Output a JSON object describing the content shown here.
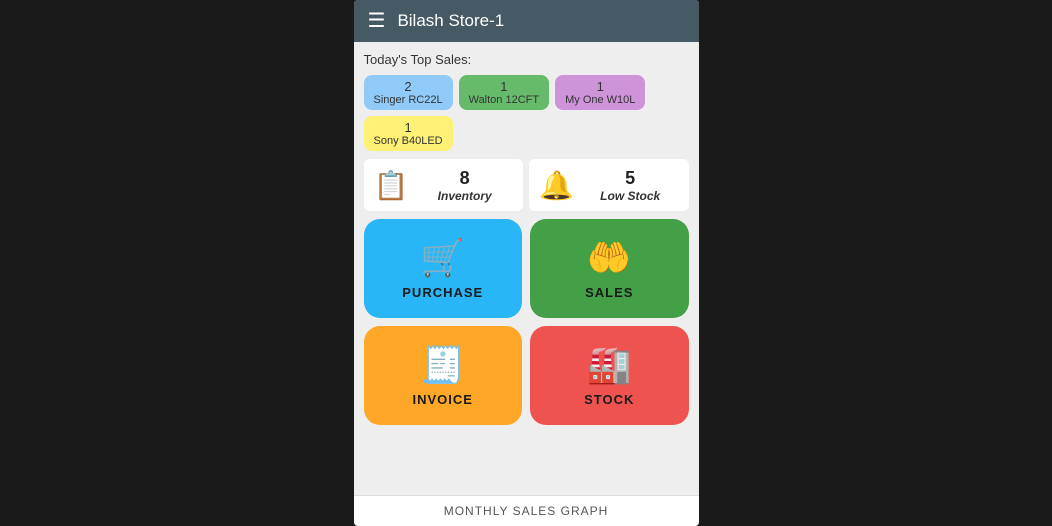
{
  "header": {
    "title": "Bilash Store-1",
    "menu_icon": "☰"
  },
  "today_sales": {
    "label": "Today's Top Sales:",
    "chips": [
      {
        "count": "2",
        "name": "Singer RC22L",
        "color": "chip-blue"
      },
      {
        "count": "1",
        "name": "Walton 12CFT",
        "color": "chip-green"
      },
      {
        "count": "1",
        "name": "My One W10L",
        "color": "chip-purple"
      },
      {
        "count": "1",
        "name": "Sony B40LED",
        "color": "chip-yellow"
      }
    ]
  },
  "stats": [
    {
      "number": "8",
      "label": "Inventory",
      "icon": "📄"
    },
    {
      "number": "5",
      "label": "Low Stock",
      "icon": "🔔"
    }
  ],
  "actions": [
    {
      "key": "purchase",
      "label": "PURCHASE",
      "icon": "🛒"
    },
    {
      "key": "sales",
      "label": "SALES",
      "icon": "🤲"
    },
    {
      "key": "invoice",
      "label": "INVOICE",
      "icon": "🧾"
    },
    {
      "key": "stock",
      "label": "STOCK",
      "icon": "🏭"
    }
  ],
  "bottom_bar": {
    "label": "MONTHLY SALES GRAPH"
  }
}
